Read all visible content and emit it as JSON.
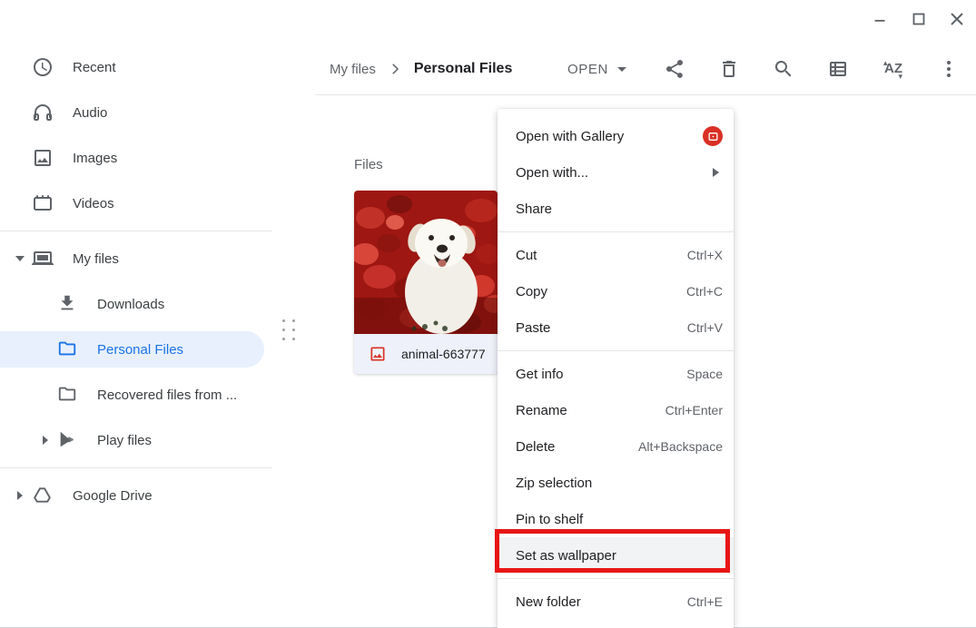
{
  "window": {
    "controls": {
      "minimize": "minimize",
      "maximize": "maximize",
      "close": "close"
    }
  },
  "sidebar": {
    "items": [
      {
        "label": "Recent",
        "icon": "clock-icon"
      },
      {
        "label": "Audio",
        "icon": "headphones-icon"
      },
      {
        "label": "Images",
        "icon": "image-icon"
      },
      {
        "label": "Videos",
        "icon": "video-icon"
      },
      {
        "label": "My files",
        "icon": "laptop-icon",
        "expanded": true
      },
      {
        "label": "Downloads",
        "icon": "download-icon",
        "indent": 1
      },
      {
        "label": "Personal Files",
        "icon": "folder-icon",
        "indent": 1,
        "selected": true
      },
      {
        "label": "Recovered files from ...",
        "icon": "folder-icon",
        "indent": 1
      },
      {
        "label": "Play files",
        "icon": "play-icon",
        "indent": 1,
        "collapsed": true
      },
      {
        "label": "Google Drive",
        "icon": "drive-icon",
        "collapsed": true
      }
    ]
  },
  "toolbar": {
    "breadcrumb": {
      "parent": "My files",
      "current": "Personal Files"
    },
    "open_label": "OPEN",
    "sort_letters": "AZ",
    "icons": [
      "share-icon",
      "trash-icon",
      "search-icon",
      "table-view-icon",
      "sort-name-icon",
      "more-vert-icon"
    ]
  },
  "main": {
    "section_label": "Files",
    "file": {
      "name": "animal-663777",
      "type": "image"
    }
  },
  "context_menu": {
    "items": [
      {
        "label": "Open with Gallery",
        "trailing_icon": "gallery-app-icon"
      },
      {
        "label": "Open with...",
        "submenu": true
      },
      {
        "label": "Share"
      },
      {
        "divider": true
      },
      {
        "label": "Cut",
        "shortcut": "Ctrl+X"
      },
      {
        "label": "Copy",
        "shortcut": "Ctrl+C"
      },
      {
        "label": "Paste",
        "shortcut": "Ctrl+V"
      },
      {
        "divider": true
      },
      {
        "label": "Get info",
        "shortcut": "Space"
      },
      {
        "label": "Rename",
        "shortcut": "Ctrl+Enter"
      },
      {
        "label": "Delete",
        "shortcut": "Alt+Backspace"
      },
      {
        "label": "Zip selection"
      },
      {
        "label": "Pin to shelf"
      },
      {
        "label": "Set as wallpaper",
        "highlighted": true
      },
      {
        "divider": true
      },
      {
        "label": "New folder",
        "shortcut": "Ctrl+E"
      }
    ]
  },
  "annotation": {
    "type": "highlight-box",
    "target": "Set as wallpaper",
    "color": "#e81515"
  },
  "colors": {
    "accent_blue": "#1a73e8",
    "selected_bg": "#e8f0fe",
    "text_primary": "#202124",
    "text_secondary": "#5f6368",
    "menu_highlight": "#f1f3f4",
    "annotation_red": "#e81515",
    "gallery_red": "#d93025",
    "file_icon_red": "#d93025"
  }
}
